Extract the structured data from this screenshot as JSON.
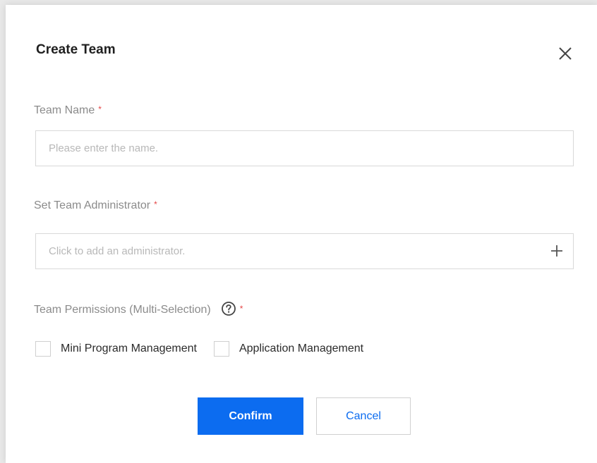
{
  "dialog": {
    "title": "Create Team",
    "close_icon": "close-icon"
  },
  "team_name": {
    "label": "Team Name",
    "required_mark": "*",
    "placeholder": "Please enter the name.",
    "value": ""
  },
  "administrator": {
    "label": "Set Team Administrator",
    "required_mark": "*",
    "placeholder": "Click to add an administrator.",
    "add_icon": "plus-icon"
  },
  "permissions": {
    "label": "Team Permissions (Multi-Selection)",
    "help_icon": "question-circle-icon",
    "required_mark": "*",
    "options": [
      {
        "label": "Mini Program Management",
        "checked": false
      },
      {
        "label": "Application Management",
        "checked": false
      }
    ]
  },
  "actions": {
    "confirm_label": "Confirm",
    "cancel_label": "Cancel"
  },
  "colors": {
    "primary": "#0c6cf0",
    "required": "#e54545",
    "label": "#8b8b8b",
    "placeholder": "#b8b8b8"
  }
}
